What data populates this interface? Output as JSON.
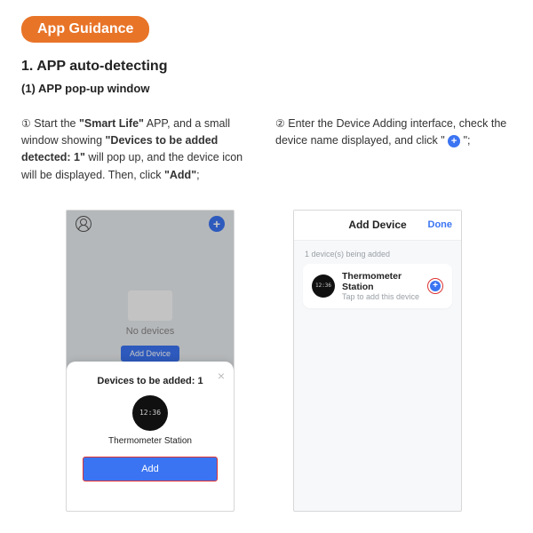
{
  "badge": "App Guidance",
  "section_title": "1. APP auto-detecting",
  "section_sub": "(1) APP pop-up window",
  "step1": {
    "marker": "①",
    "pre": " Start the ",
    "bold1": "\"Smart Life\"",
    "mid1": " APP, and a small window showing ",
    "bold2": "\"Devices to be added detected: 1\"",
    "mid2": " will pop up, and the device icon will be displayed. Then, click ",
    "bold3": "\"Add\"",
    "tail": ";"
  },
  "step2": {
    "marker": "②",
    "pre": " Enter the Device Adding interface, check the device name displayed, and click \" ",
    "tail": " \";"
  },
  "phone1": {
    "empty_label": "No devices",
    "ghost_button": "Add Device",
    "popup_title": "Devices to be added: 1",
    "device_time": "12:36",
    "device_name": "Thermometer Station",
    "add_button": "Add"
  },
  "phone2": {
    "header": "Add Device",
    "done": "Done",
    "being_added": "1 device(s) being added",
    "device_name": "Thermometer Station",
    "tap_hint": "Tap to add this device"
  }
}
